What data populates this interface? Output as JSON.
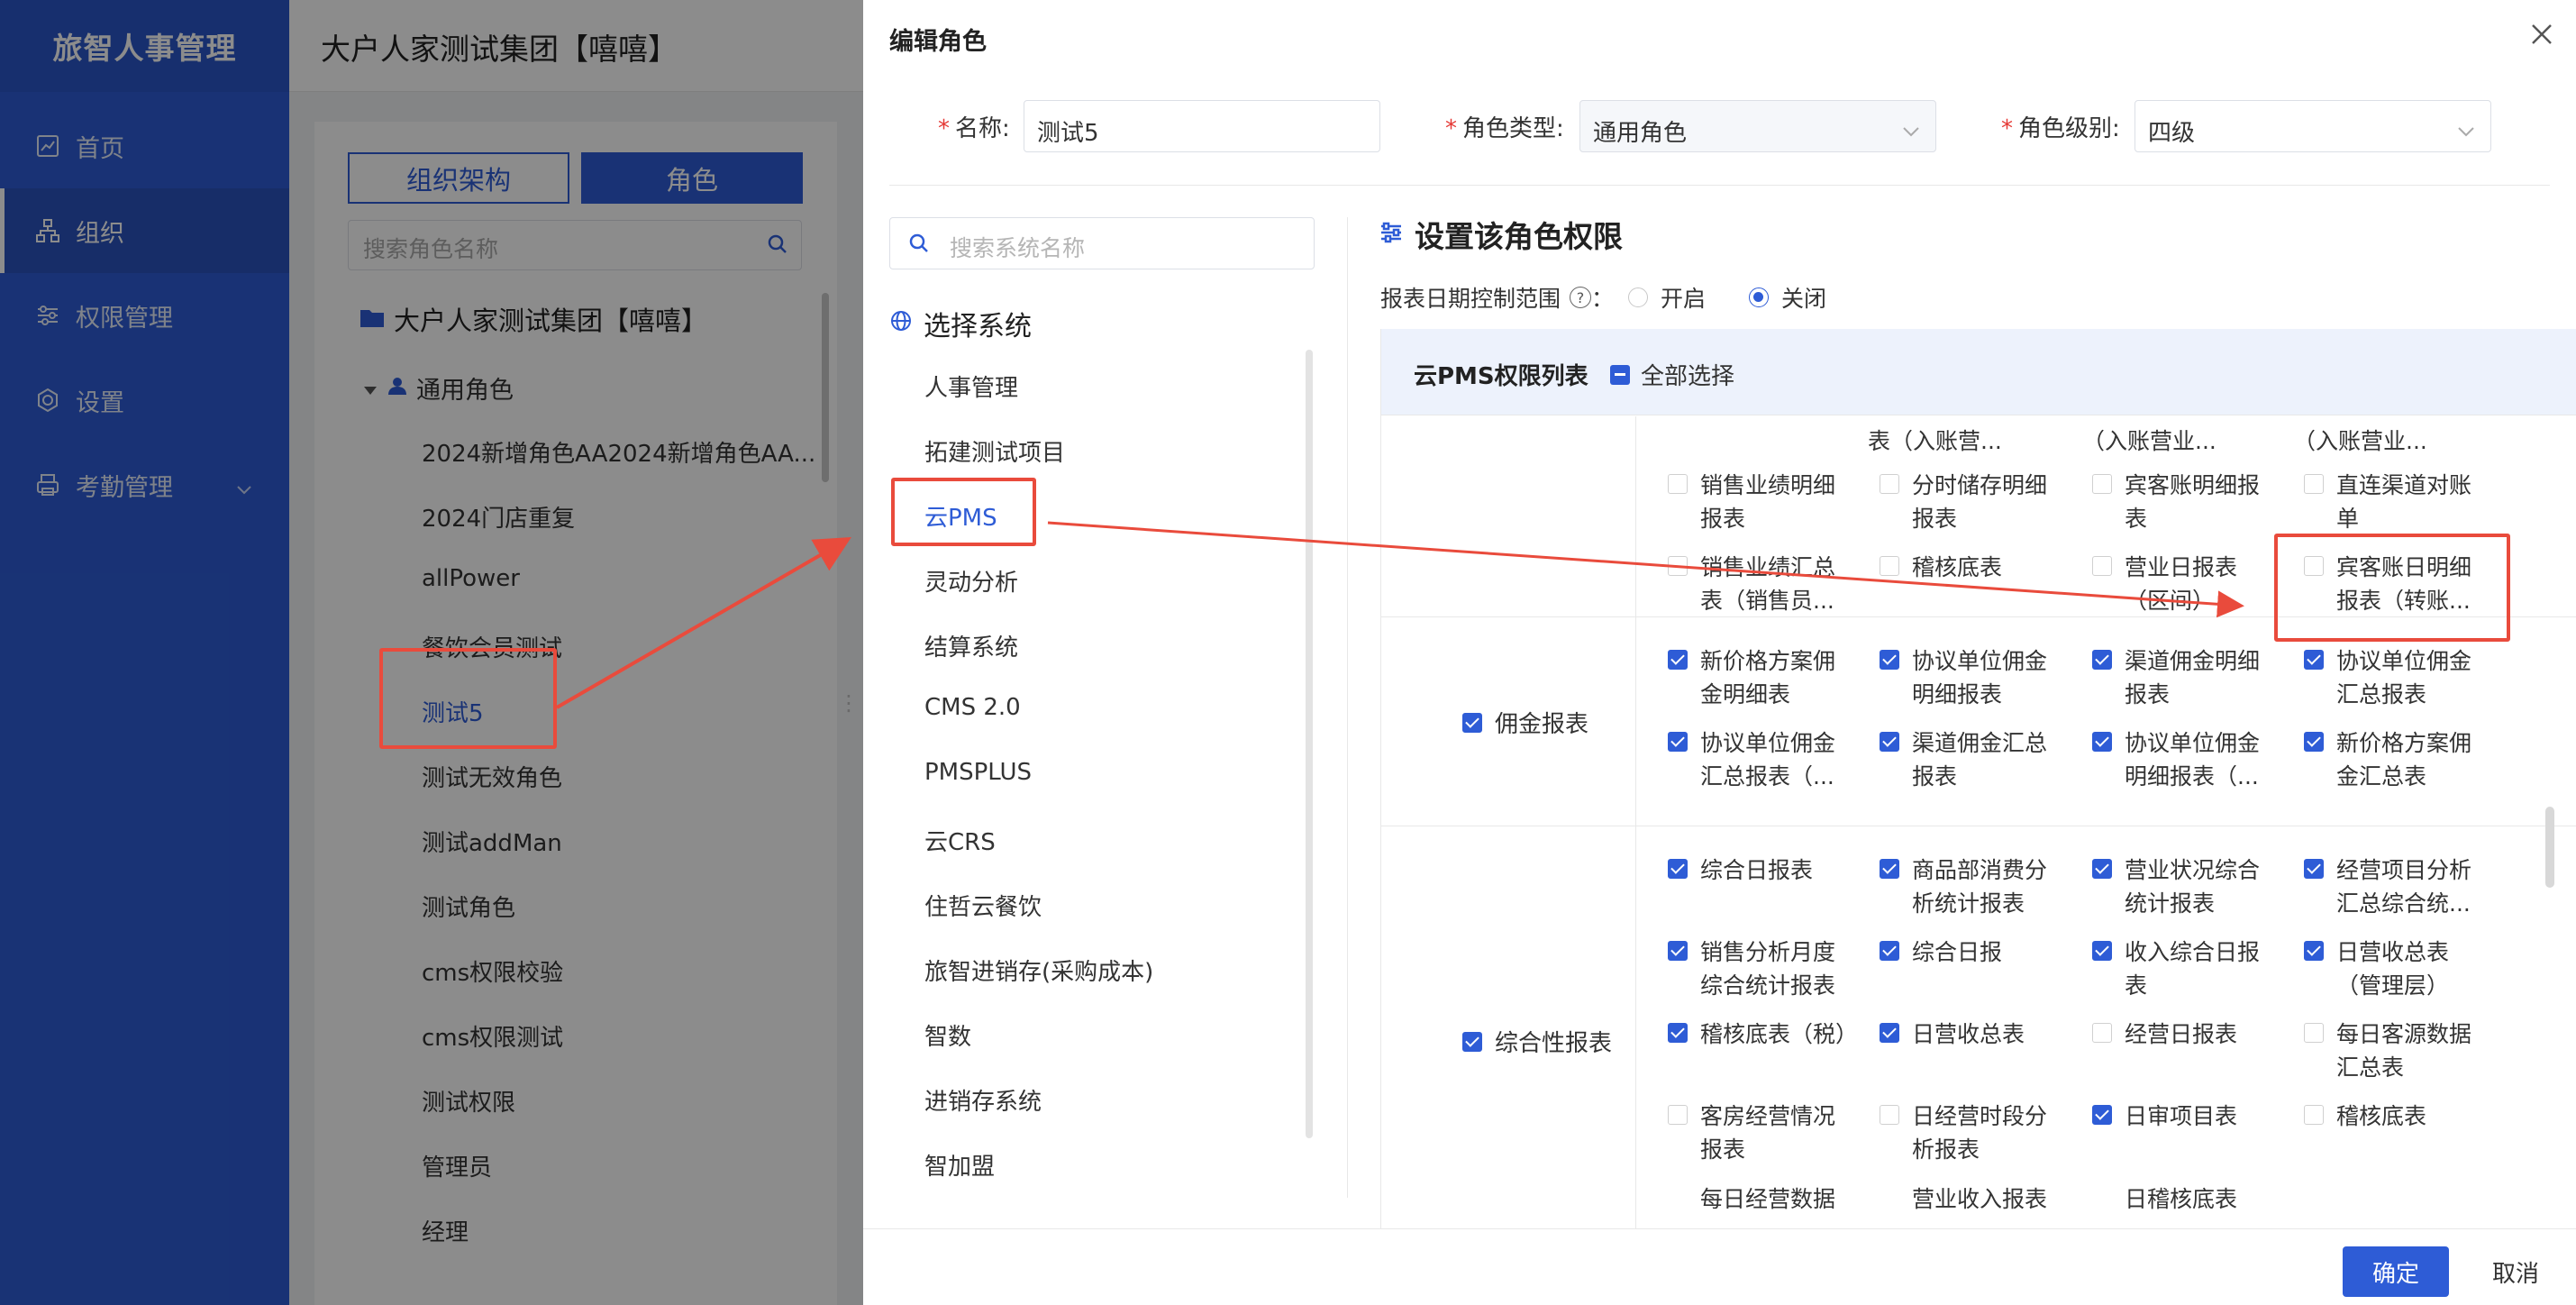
{
  "app": {
    "brand": "旅智人事管理",
    "org_title": "大户人家测试集团【嘻嘻】"
  },
  "sidebar": {
    "items": [
      {
        "label": "首页",
        "icon": "chart-icon"
      },
      {
        "label": "组织",
        "icon": "org-icon"
      },
      {
        "label": "权限管理",
        "icon": "sliders-icon"
      },
      {
        "label": "设置",
        "icon": "gear-icon"
      },
      {
        "label": "考勤管理",
        "icon": "printer-icon"
      }
    ]
  },
  "role_panel": {
    "tab_org": "组织架构",
    "tab_role": "角色",
    "search_placeholder": "搜索角色名称",
    "tree_root": "大户人家测试集团【嘻嘻】",
    "group": "通用角色",
    "roles": [
      "2024新增角色AA2024新增角色AA...",
      "2024门店重复",
      "allPower",
      "餐饮会员测试",
      "测试5",
      "测试无效角色",
      "测试addMan",
      "测试角色",
      "cms权限校验",
      "cms权限测试",
      "测试权限",
      "管理员",
      "经理"
    ]
  },
  "drawer": {
    "title": "编辑角色",
    "name_label": "名称:",
    "name_value": "测试5",
    "type_label": "角色类型:",
    "type_value": "通用角色",
    "level_label": "角色级别:",
    "level_value": "四级",
    "sys_search_placeholder": "搜索系统名称",
    "sys_title": "选择系统",
    "systems": [
      "人事管理",
      "拓建测试项目",
      "云PMS",
      "灵动分析",
      "结算系统",
      "CMS 2.0",
      "PMSPLUS",
      "云CRS",
      "住哲云餐饮",
      "旅智进销存(采购成本)",
      "智数",
      "进销存系统",
      "智加盟"
    ],
    "perm_title": "设置该角色权限",
    "date_label": "报表日期控制范围",
    "date_on": "开启",
    "date_off": "关闭",
    "table_title": "云PMS权限列表",
    "select_all": "全部选择",
    "cut_top": [
      "表（入账营...",
      "（入账营业...",
      "（入账营业..."
    ],
    "row1_items": [
      {
        "text": "销售业绩明细报表",
        "checked": false
      },
      {
        "text": "分时储存明细报表",
        "checked": false
      },
      {
        "text": "宾客账明细报表",
        "checked": false
      },
      {
        "text": "直连渠道对账单",
        "checked": false
      },
      {
        "text": "销售业绩汇总表（销售员...",
        "checked": false
      },
      {
        "text": "稽核底表",
        "checked": false
      },
      {
        "text": "营业日报表（区间）",
        "checked": false
      },
      {
        "text": "宾客账日明细报表（转账...",
        "checked": false
      }
    ],
    "row2_cat": "佣金报表",
    "row2_items": [
      {
        "text": "新价格方案佣金明细表",
        "checked": true
      },
      {
        "text": "协议单位佣金明细报表",
        "checked": true
      },
      {
        "text": "渠道佣金明细报表",
        "checked": true
      },
      {
        "text": "协议单位佣金汇总报表",
        "checked": true
      },
      {
        "text": "协议单位佣金汇总报表（...",
        "checked": true
      },
      {
        "text": "渠道佣金汇总报表",
        "checked": true
      },
      {
        "text": "协议单位佣金明细报表（...",
        "checked": true
      },
      {
        "text": "新价格方案佣金汇总表",
        "checked": true
      }
    ],
    "row3_cat": "综合性报表",
    "row3_items": [
      {
        "text": "综合日报表",
        "checked": true
      },
      {
        "text": "商品部消费分析统计报表",
        "checked": true
      },
      {
        "text": "营业状况综合统计报表",
        "checked": true
      },
      {
        "text": "经营项目分析汇总综合统...",
        "checked": true
      },
      {
        "text": "销售分析月度综合统计报表",
        "checked": true
      },
      {
        "text": "综合日报",
        "checked": true
      },
      {
        "text": "收入综合日报表",
        "checked": true
      },
      {
        "text": "日营收总表（管理层）",
        "checked": true
      },
      {
        "text": "稽核底表（税）",
        "checked": true
      },
      {
        "text": "日营收总表",
        "checked": true
      },
      {
        "text": "经营日报表",
        "checked": false
      },
      {
        "text": "每日客源数据汇总表",
        "checked": false
      },
      {
        "text": "客房经营情况报表",
        "checked": false
      },
      {
        "text": "日经营时段分析报表",
        "checked": false
      },
      {
        "text": "日审项目表",
        "checked": true
      },
      {
        "text": "稽核底表",
        "checked": false
      }
    ],
    "cut_bottom": [
      "每日经营数据",
      "营业收入报表",
      "日稽核底表"
    ],
    "ok": "确定",
    "cancel": "取消"
  },
  "colors": {
    "primary": "#2e5cd6",
    "annotation": "#e94b3c"
  }
}
